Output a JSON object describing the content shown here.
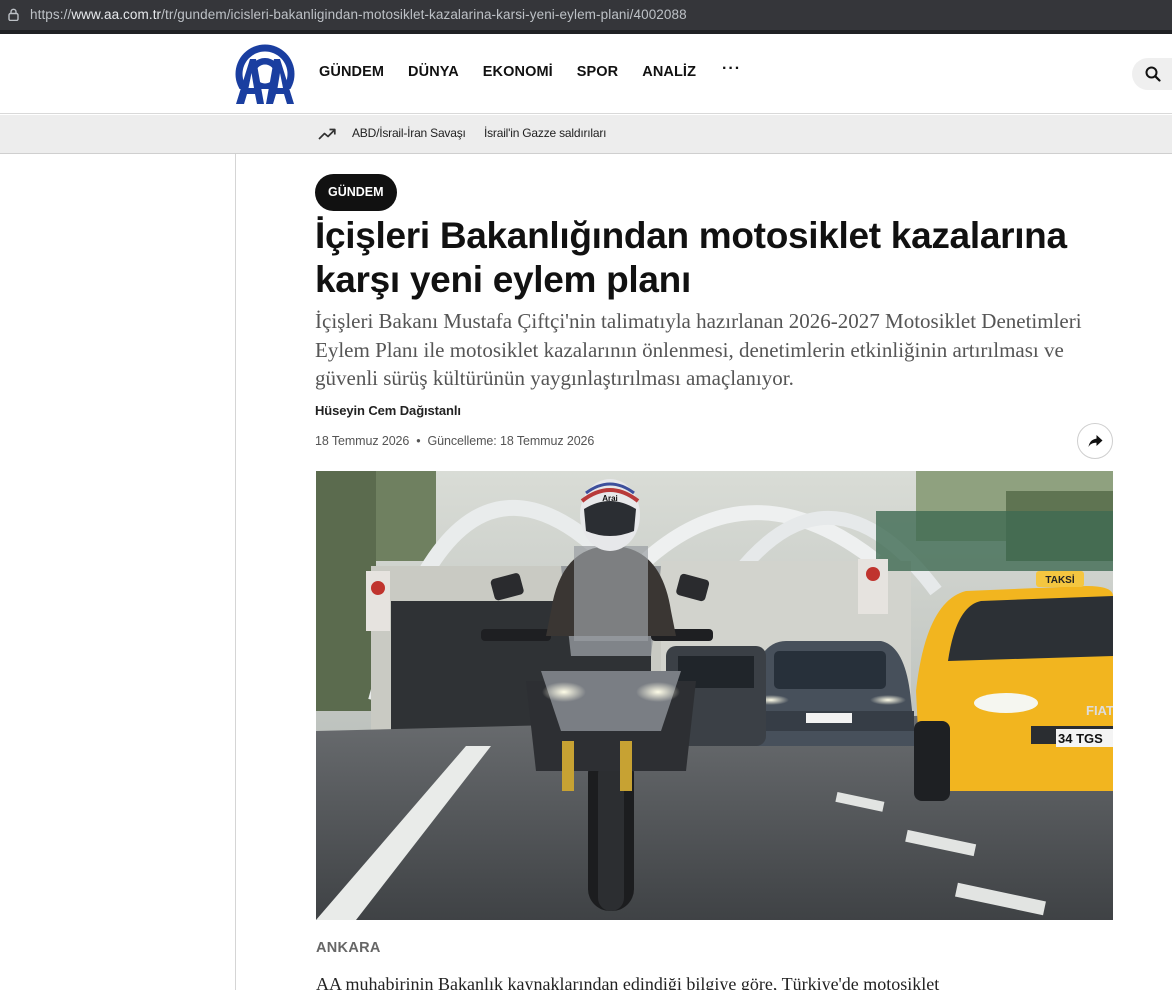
{
  "browser": {
    "url_prefix": "https://",
    "url_domain": "www.aa.com.tr",
    "url_path": "/tr/gundem/icisleri-bakanligindan-motosiklet-kazalarina-karsi-yeni-eylem-plani/4002088"
  },
  "header": {
    "nav": [
      "GÜNDEM",
      "DÜNYA",
      "EKONOMİ",
      "SPOR",
      "ANALİZ"
    ],
    "more": "···"
  },
  "trending": {
    "links": [
      "ABD/İsrail-İran Savaşı",
      "İsrail'in Gazze saldırıları"
    ]
  },
  "article": {
    "category": "GÜNDEM",
    "headline": "İçişleri Bakanlığından motosiklet kazalarına karşı yeni eylem planı",
    "summary": "İçişleri Bakanı Mustafa Çiftçi'nin talimatıyla hazırlanan 2026-2027 Motosiklet Denetimleri Eylem Planı ile motosiklet kazalarının önlenmesi, denetimlerin etkinliğinin artırılması ve güvenli sürüş kültürünün yaygınlaştırılması amaçlanıyor.",
    "author": "Hüseyin Cem Dağıstanlı",
    "date": "18 Temmuz 2026",
    "date_separator": "•",
    "updated": "Güncelleme: 18 Temmuz 2026",
    "dateline": "ANKARA",
    "body_start": "AA muhabirinin Bakanlık kaynaklarından edindiği bilgiye göre, Türkiye'de motosiklet",
    "photo": {
      "helmet_brand": "Arai",
      "taxi_sign": "TAKSİ",
      "taxi_plate": "34 TGS",
      "car_brand": "FIAT"
    }
  },
  "colors": {
    "brand_blue": "#1a3ea0",
    "pill_bg": "#111111",
    "taxi_yellow": "#f2b51f"
  },
  "icons": [
    "lock-icon",
    "aa-logo",
    "search-icon",
    "trending-icon",
    "share-icon"
  ]
}
